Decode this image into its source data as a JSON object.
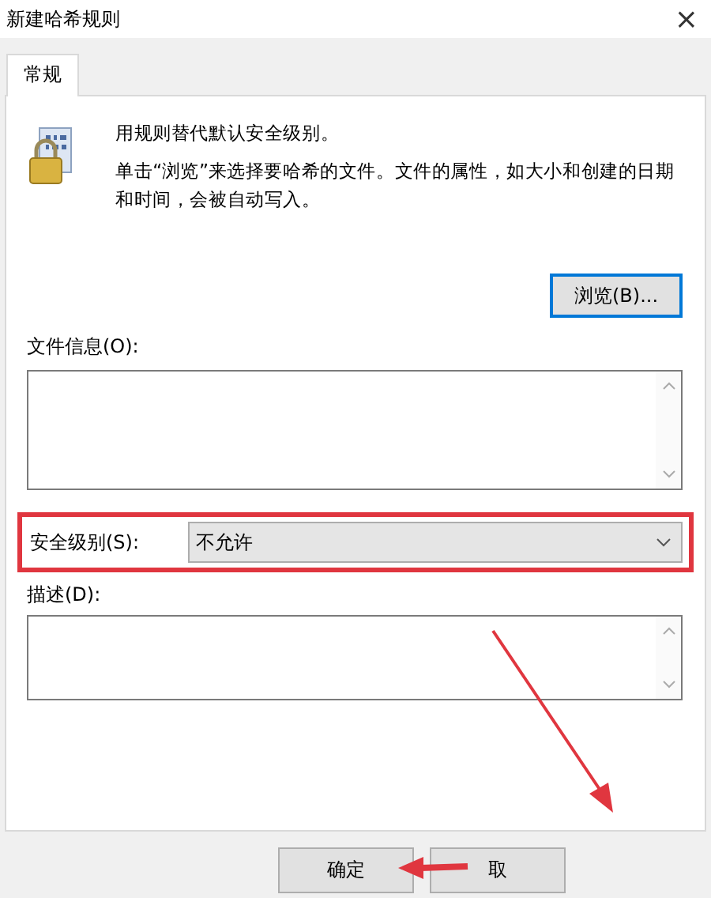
{
  "window": {
    "title": "新建哈希规则",
    "close": "×"
  },
  "tabs": [
    {
      "label": "常规",
      "selected": true
    }
  ],
  "intro": {
    "heading": "用规则替代默认安全级别。",
    "text": "单击“浏览”来选择要哈希的文件。文件的属性，如大小和创建的日期和时间，会被自动写入。"
  },
  "browse_button": "浏览(B)...",
  "file_info": {
    "label": "文件信息(O):"
  },
  "security_level": {
    "label": "安全级别(S):",
    "value": "不允许",
    "highlighted": true
  },
  "description": {
    "label": "描述(D):"
  },
  "buttons": [
    {
      "label": "确定"
    },
    {
      "label": "取"
    }
  ],
  "annotations": [
    {
      "kind": "arrow"
    },
    {
      "kind": "arrow"
    }
  ]
}
